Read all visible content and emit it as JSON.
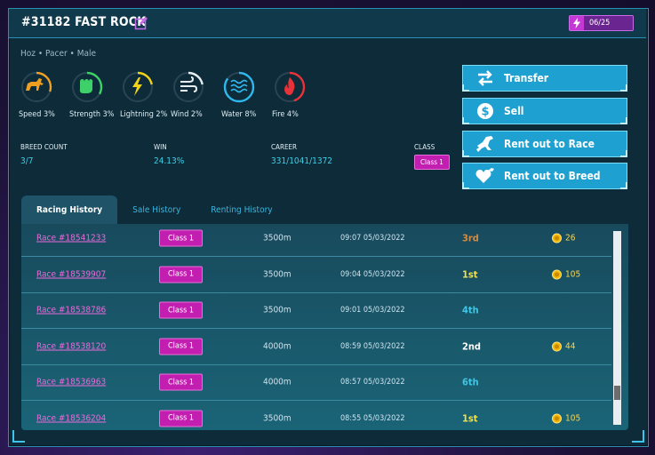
{
  "horse": {
    "title": "#31182 FAST ROCK",
    "meta": "Hoz  •  Pacer  •  Male",
    "energy": "06/25"
  },
  "stats": [
    {
      "label": "Speed 3%",
      "color": "#f0a020",
      "pct": 0.3
    },
    {
      "label": "Strength 3%",
      "color": "#3ed16a",
      "pct": 0.33
    },
    {
      "label": "Lightning 2%",
      "color": "#f2d21a",
      "pct": 0.22
    },
    {
      "label": "Wind 2%",
      "color": "#e6eef2",
      "pct": 0.22
    },
    {
      "label": "Water 8%",
      "color": "#2fb8ec",
      "pct": 0.85
    },
    {
      "label": "Fire 4%",
      "color": "#e8323a",
      "pct": 0.45
    }
  ],
  "info": {
    "breed_label": "BREED COUNT",
    "breed_value": "3/7",
    "win_label": "WIN",
    "win_value": "24.13%",
    "career_label": "CAREER",
    "career_value": "331/1041/1372",
    "class_label": "CLASS",
    "class_value": "Class 1"
  },
  "buttons": {
    "transfer": "Transfer",
    "sell": "Sell",
    "rent_race": "Rent out to Race",
    "rent_breed": "Rent out to Breed"
  },
  "tabs": [
    "Racing History",
    "Sale History",
    "Renting History"
  ],
  "rows": [
    {
      "race": "Race #18541233",
      "class": "Class 1",
      "distance": "3500m",
      "date": "09:07 05/03/2022",
      "place": "3rd",
      "place_color": "#d88a3a",
      "reward": "26"
    },
    {
      "race": "Race #18539907",
      "class": "Class 1",
      "distance": "3500m",
      "date": "09:04 05/03/2022",
      "place": "1st",
      "place_color": "#f2e14a",
      "reward": "105"
    },
    {
      "race": "Race #18538786",
      "class": "Class 1",
      "distance": "3500m",
      "date": "09:01 05/03/2022",
      "place": "4th",
      "place_color": "#3fc8e6",
      "reward": ""
    },
    {
      "race": "Race #18538120",
      "class": "Class 1",
      "distance": "4000m",
      "date": "08:59 05/03/2022",
      "place": "2nd",
      "place_color": "#ffffff",
      "reward": "44"
    },
    {
      "race": "Race #18536963",
      "class": "Class 1",
      "distance": "4000m",
      "date": "08:57 05/03/2022",
      "place": "6th",
      "place_color": "#3fc8e6",
      "reward": ""
    },
    {
      "race": "Race #18536204",
      "class": "Class 1",
      "distance": "3500m",
      "date": "08:55 05/03/2022",
      "place": "1st",
      "place_color": "#f2e14a",
      "reward": "105"
    }
  ]
}
